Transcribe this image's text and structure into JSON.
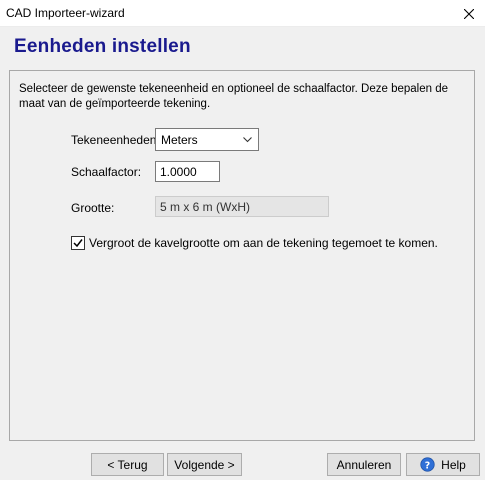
{
  "window": {
    "title": "CAD Importeer-wizard"
  },
  "header": {
    "heading": "Eenheden instellen"
  },
  "main": {
    "description": "Selecteer de gewenste tekeneenheid en optioneel de schaalfactor. Deze bepalen de maat van de geïmporteerde tekening.",
    "units_label": "Tekeneenheden:",
    "units_value": "Meters",
    "scale_label": "Schaalfactor:",
    "scale_value": "1.0000",
    "size_label": "Grootte:",
    "size_value": "5 m x 6 m (WxH)",
    "checkbox_label": "Vergroot de kavelgrootte om aan de tekening tegemoet te komen.",
    "checkbox_checked": true
  },
  "footer": {
    "back_label": "< Terug",
    "next_label": "Volgende >",
    "cancel_label": "Annuleren",
    "help_label": "Help"
  },
  "icons": {
    "close": "close-icon",
    "dropdown": "chevron-down-icon",
    "check": "checkmark-icon",
    "help": "help-icon"
  },
  "colors": {
    "heading": "#1a1a8e",
    "focus_border": "#0078d7"
  }
}
